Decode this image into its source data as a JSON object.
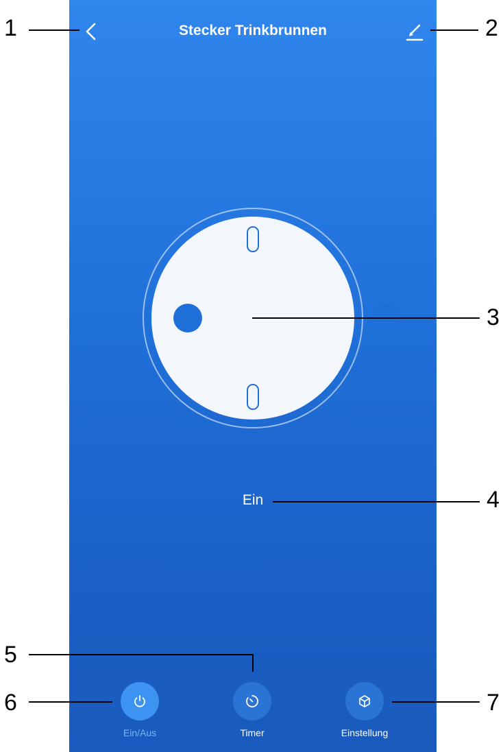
{
  "header": {
    "title": "Stecker Trinkbrunnen",
    "back_icon": "chevron-left-icon",
    "edit_icon": "pencil-icon"
  },
  "socket": {
    "icon": "schuko-socket-icon"
  },
  "status": {
    "text": "Ein"
  },
  "nav": [
    {
      "label": "Ein/Aus",
      "icon": "power-icon",
      "active": true
    },
    {
      "label": "Timer",
      "icon": "timer-icon",
      "active": false
    },
    {
      "label": "Einstellung",
      "icon": "cube-icon",
      "active": false
    }
  ],
  "callouts": [
    "1",
    "2",
    "3",
    "4",
    "5",
    "6",
    "7"
  ],
  "colors": {
    "background": "#1f6fd8",
    "active_button": "#3d93f1",
    "inactive_button": "#2a74d6",
    "active_label": "#7fb3f2"
  }
}
